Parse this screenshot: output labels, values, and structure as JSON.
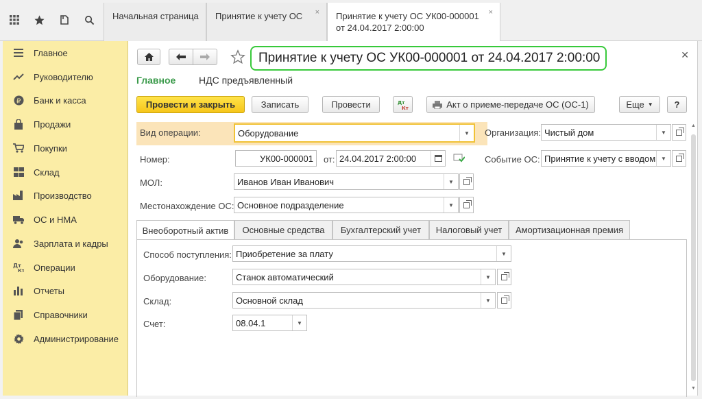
{
  "tabs": [
    {
      "label": "Начальная страница"
    },
    {
      "label": "Принятие к учету ОС",
      "close": "×"
    },
    {
      "label_line1": "Принятие к учету ОС УК00-000001",
      "label_line2": "от 24.04.2017 2:00:00",
      "close": "×"
    }
  ],
  "sidebar": {
    "items": [
      {
        "label": "Главное",
        "icon": "menu-icon"
      },
      {
        "label": "Руководителю",
        "icon": "trend-icon"
      },
      {
        "label": "Банк и касса",
        "icon": "ruble-icon"
      },
      {
        "label": "Продажи",
        "icon": "bag-icon"
      },
      {
        "label": "Покупки",
        "icon": "cart-icon"
      },
      {
        "label": "Склад",
        "icon": "warehouse-icon"
      },
      {
        "label": "Производство",
        "icon": "factory-icon"
      },
      {
        "label": "ОС и НМА",
        "icon": "truck-icon"
      },
      {
        "label": "Зарплата и кадры",
        "icon": "people-icon"
      },
      {
        "label": "Операции",
        "icon": "dt-kt-icon"
      },
      {
        "label": "Отчеты",
        "icon": "bar-chart-icon"
      },
      {
        "label": "Справочники",
        "icon": "books-icon"
      },
      {
        "label": "Администрирование",
        "icon": "gear-icon"
      }
    ]
  },
  "doc": {
    "title": "Принятие к учету ОС УК00-000001 от 24.04.2017 2:00:00",
    "subtabs": [
      "Главное",
      "НДС предъявленный"
    ],
    "buttons": {
      "post_close": "Провести и закрыть",
      "save": "Записать",
      "post": "Провести",
      "dt_kt": "Дт Кт",
      "print_act": "Акт о приеме-передаче ОС (ОС-1)",
      "more": "Еще",
      "help": "?"
    },
    "fields": {
      "op_type_label": "Вид операции:",
      "op_type_value": "Оборудование",
      "number_label": "Номер:",
      "number_value": "УК00-000001",
      "date_label": "от:",
      "date_value": "24.04.2017  2:00:00",
      "mol_label": "МОЛ:",
      "mol_value": "Иванов Иван Иванович",
      "location_label": "Местонахождение ОС:",
      "location_value": "Основное подразделение",
      "org_label": "Организация:",
      "org_value": "Чистый дом",
      "event_label": "Событие ОС:",
      "event_value": "Принятие к учету с вводом"
    },
    "form_tabs": [
      "Внеоборотный актив",
      "Основные средства",
      "Бухгалтерский учет",
      "Налоговый учет",
      "Амортизационная премия"
    ],
    "asset": {
      "receipt_label": "Способ поступления:",
      "receipt_value": "Приобретение за плату",
      "equipment_label": "Оборудование:",
      "equipment_value": "Станок автоматический",
      "warehouse_label": "Склад:",
      "warehouse_value": "Основной склад",
      "account_label": "Счет:",
      "account_value": "08.04.1"
    }
  }
}
